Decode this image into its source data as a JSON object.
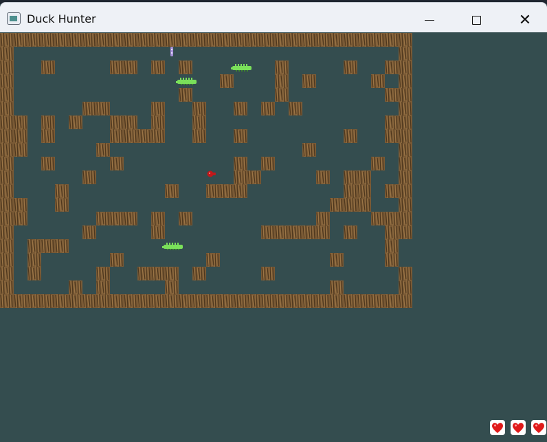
{
  "window": {
    "title": "Duck Hunter",
    "minimize_icon": "minimize-icon",
    "maximize_icon": "maximize-icon",
    "close_icon": "close-icon"
  },
  "colors": {
    "background": "#344d4f",
    "dirt": "#7a5a35",
    "dirt_dark": "#4e371d",
    "crocodile": "#7ae05a",
    "player": "#c1181b",
    "rabbit": "#a58fd8",
    "heart": "#e01a1a"
  },
  "board": {
    "cols": 30,
    "rows": 20,
    "tiles": [
      "##############################",
      "#............................#",
      "#..#....##.#.#......#....#..##",
      "#...............#...#.#....#.#",
      "#............#......#.......##",
      "#.....##...#..#..#.#.#.......#",
      "##.#.#..##.#..#.............##",
      "##.#....####..#..#.......#..##",
      "##.....#..............#......#",
      "#..#....#........#.#.......#.#",
      "#.....#..........##....#.##..##",
      "#...#.......#..###.......##.##",
      "##..#...................###..#",
      "##.....###.#.#.........#...###",
      "#.....#....#.......#####.#..##",
      "#.###.......................#.#",
      "#.#.....#......#........#...#.#",
      "#.#....#..###.#....#.........#",
      "#....#.#....#...........#....#",
      "##############################"
    ],
    "entities": [
      {
        "type": "crocodile",
        "col": 17,
        "row": 2
      },
      {
        "type": "crocodile",
        "col": 13,
        "row": 3
      },
      {
        "type": "crocodile",
        "col": 12,
        "row": 15
      },
      {
        "type": "player-duck",
        "col": 15,
        "row": 10
      },
      {
        "type": "rabbit",
        "col": 12,
        "row": 1
      }
    ]
  },
  "lives": {
    "count": 3,
    "icon": "heart-icon"
  }
}
